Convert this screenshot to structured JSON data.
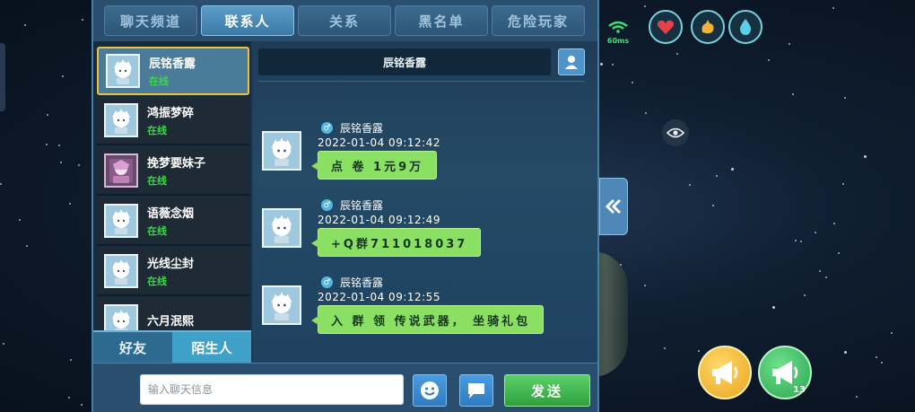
{
  "tabs": [
    "聊天频道",
    "联系人",
    "关系",
    "黑名单",
    "危险玩家"
  ],
  "active_tab_index": 1,
  "contacts": [
    {
      "name": "辰铭香露",
      "status": "在线",
      "selected": true
    },
    {
      "name": "鸿振梦碎",
      "status": "在线",
      "selected": false
    },
    {
      "name": "挽梦要妹子",
      "status": "在线",
      "selected": false
    },
    {
      "name": "语薇念烟",
      "status": "在线",
      "selected": false
    },
    {
      "name": "光线尘封",
      "status": "在线",
      "selected": false
    },
    {
      "name": "六月泯熙",
      "status": "",
      "selected": false
    }
  ],
  "filters": {
    "friends": "好友",
    "strangers": "陌生人",
    "active": "strangers"
  },
  "chat": {
    "title": "辰铭香露",
    "messages": [
      {
        "sender": "辰铭香露",
        "time": "2022-01-04  09:12:42",
        "text": "点 卷 1元9万"
      },
      {
        "sender": "辰铭香露",
        "time": "2022-01-04  09:12:49",
        "text": "+Q群711018037"
      },
      {
        "sender": "辰铭香露",
        "time": "2022-01-04  09:12:55",
        "text": "入 群 领 传说武器， 坐骑礼包"
      }
    ]
  },
  "input": {
    "placeholder": "输入聊天信息",
    "value": "",
    "send_label": "发送"
  },
  "hud": {
    "ping": "60ms",
    "stats": [
      "heart-icon",
      "stamina-icon",
      "water-drop-icon"
    ],
    "broadcast_count": "13"
  },
  "colors": {
    "online": "#3cd64a",
    "bubble": "#8ae062",
    "active_tab": "#5c9cc8",
    "send": "#3fb04e"
  }
}
